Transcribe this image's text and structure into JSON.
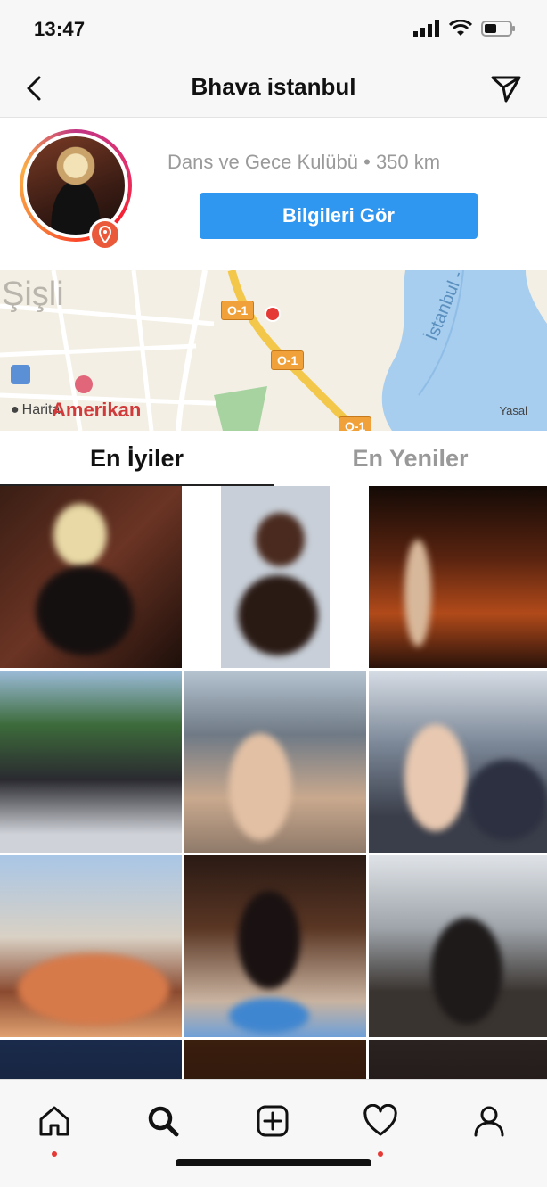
{
  "status_bar": {
    "time": "13:47"
  },
  "nav": {
    "title": "Bhava istanbul",
    "back_icon": "chevron-left-icon",
    "send_icon": "paper-plane-icon"
  },
  "profile": {
    "subtitle": "Dans ve Gece Kulübü • 350 km",
    "info_button_label": "Bilgileri Gör"
  },
  "map": {
    "district_label": "Şişli",
    "hospital_label": "Amerikan",
    "maps_label": "Harita",
    "legal_label": "Yasal",
    "water_label": "İstanbul - Od",
    "road_labels": [
      "O-1",
      "O-1",
      "O-1"
    ]
  },
  "tabs": [
    {
      "label": "En İyiler",
      "active": true
    },
    {
      "label": "En Yeniler",
      "active": false
    }
  ],
  "tabbar": {
    "items": [
      "home-icon",
      "search-icon",
      "add-icon",
      "heart-icon",
      "profile-icon"
    ],
    "active": "search-icon"
  },
  "colors": {
    "accent_blue": "#2f97f0",
    "badge_red": "#ea5a3a",
    "road_orange": "#f0a13a",
    "water_blue": "#a7cdef"
  }
}
